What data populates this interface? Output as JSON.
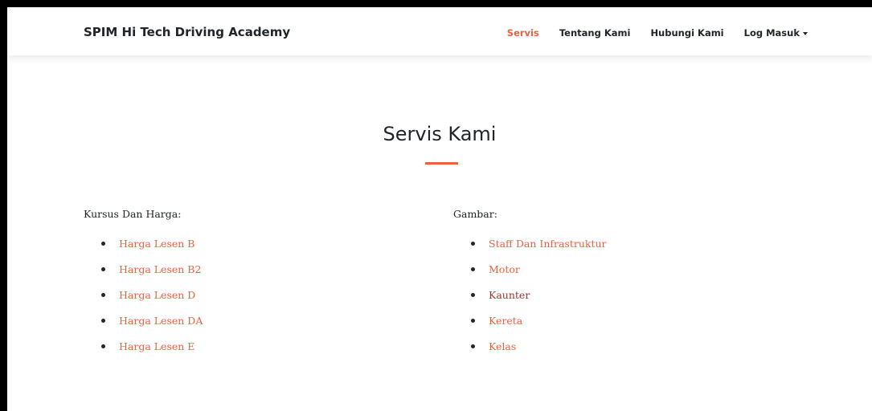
{
  "navbar": {
    "brand": "SPIM Hi Tech Driving Academy",
    "links": [
      {
        "label": "Servis",
        "active": true
      },
      {
        "label": "Tentang Kami"
      },
      {
        "label": "Hubungi Kami"
      },
      {
        "label": "Log Masuk"
      }
    ]
  },
  "section": {
    "title": "Servis Kami"
  },
  "courses": {
    "heading": "Kursus Dan Harga:",
    "items": [
      "Harga Lesen B",
      "Harga Lesen B2",
      "Harga Lesen D",
      "Harga Lesen DA",
      "Harga Lesen E"
    ]
  },
  "gallery": {
    "heading": "Gambar:",
    "items": [
      "Staff Dan Infrastruktur",
      "Motor",
      "Kaunter",
      "Kereta",
      "Kelas"
    ]
  },
  "colors": {
    "accent": "#f05f40",
    "text": "#212529",
    "visited_link": "#a0372a"
  },
  "icons": {
    "dropdown": "caret-down-icon",
    "list_marker": "bullet-icon"
  }
}
